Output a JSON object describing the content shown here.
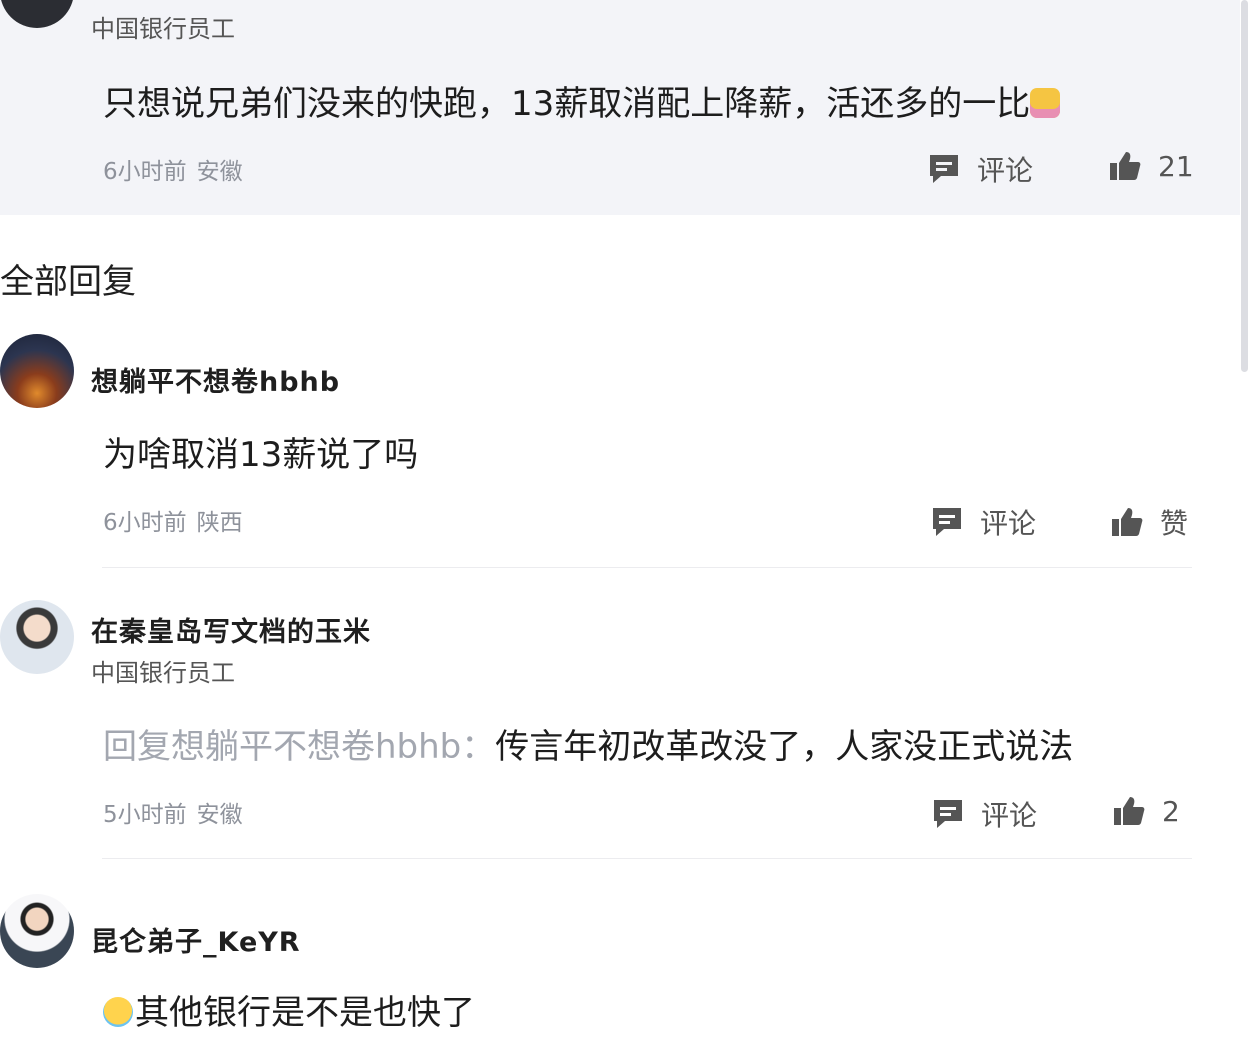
{
  "top_comment": {
    "subtitle": "中国银行员工",
    "text": "只想说兄弟们没来的快跑，13薪取消配上降薪，活还多的一比",
    "emoji": "grimace-emoji",
    "time": "6小时前",
    "location": "安徽",
    "comment_label": "评论",
    "like_count": "21"
  },
  "section_title": "全部回复",
  "replies": [
    {
      "name": "想躺平不想卷hbhb",
      "text": "为啥取消13薪说了吗",
      "time": "6小时前",
      "location": "陕西",
      "comment_label": "评论",
      "like_label": "赞"
    },
    {
      "name": "在秦皇岛写文档的玉米",
      "subtitle": "中国银行员工",
      "reply_prefix": "回复想躺平不想卷hbhb：",
      "text": "传言年初改革改没了，人家没正式说法",
      "time": "5小时前",
      "location": "安徽",
      "comment_label": "评论",
      "like_label": "2"
    },
    {
      "name": "昆仑弟子_KeYR",
      "emoji": "laugh-cry-emoji",
      "text": "其他银行是不是也快了"
    }
  ],
  "colors": {
    "top_block_bg": "#f3f4f8",
    "meta_text": "#8e929b",
    "reply_prefix": "#a3a7b0"
  }
}
